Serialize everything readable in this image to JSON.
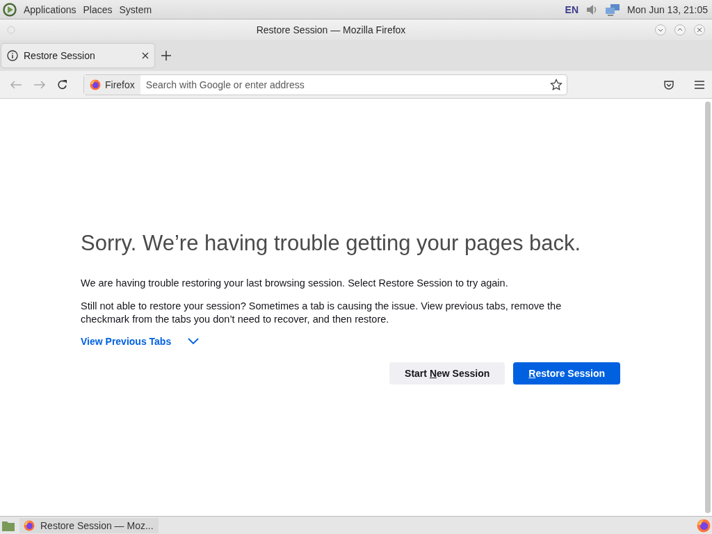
{
  "top_panel": {
    "menus": [
      "Applications",
      "Places",
      "System"
    ],
    "keyboard_layout": "EN",
    "clock": "Mon Jun 13, 21:05"
  },
  "window": {
    "title": "Restore Session — Mozilla Firefox"
  },
  "tabs": [
    {
      "label": "Restore Session",
      "selected": true
    }
  ],
  "address_bar": {
    "identity": "Firefox",
    "placeholder": "Search with Google or enter address"
  },
  "page": {
    "heading": "Sorry. We’re having trouble getting your pages back.",
    "paragraphs": [
      "We are having trouble restoring your last browsing session. Select Restore Session to try again.",
      "Still not able to restore your session? Sometimes a tab is causing the issue. View previous tabs, remove the checkmark from the tabs you don’t need to recover, and then restore."
    ],
    "view_tabs": {
      "label": "View Previous Tabs",
      "expanded": false
    },
    "buttons": [
      {
        "kind": "secondary",
        "before": "Start ",
        "key": "N",
        "after": "ew Session"
      },
      {
        "kind": "primary",
        "key": "R",
        "after": "estore Session"
      }
    ]
  },
  "taskbar": {
    "windows": [
      {
        "label": "Restore Session — Moz...",
        "selected": false
      }
    ]
  }
}
